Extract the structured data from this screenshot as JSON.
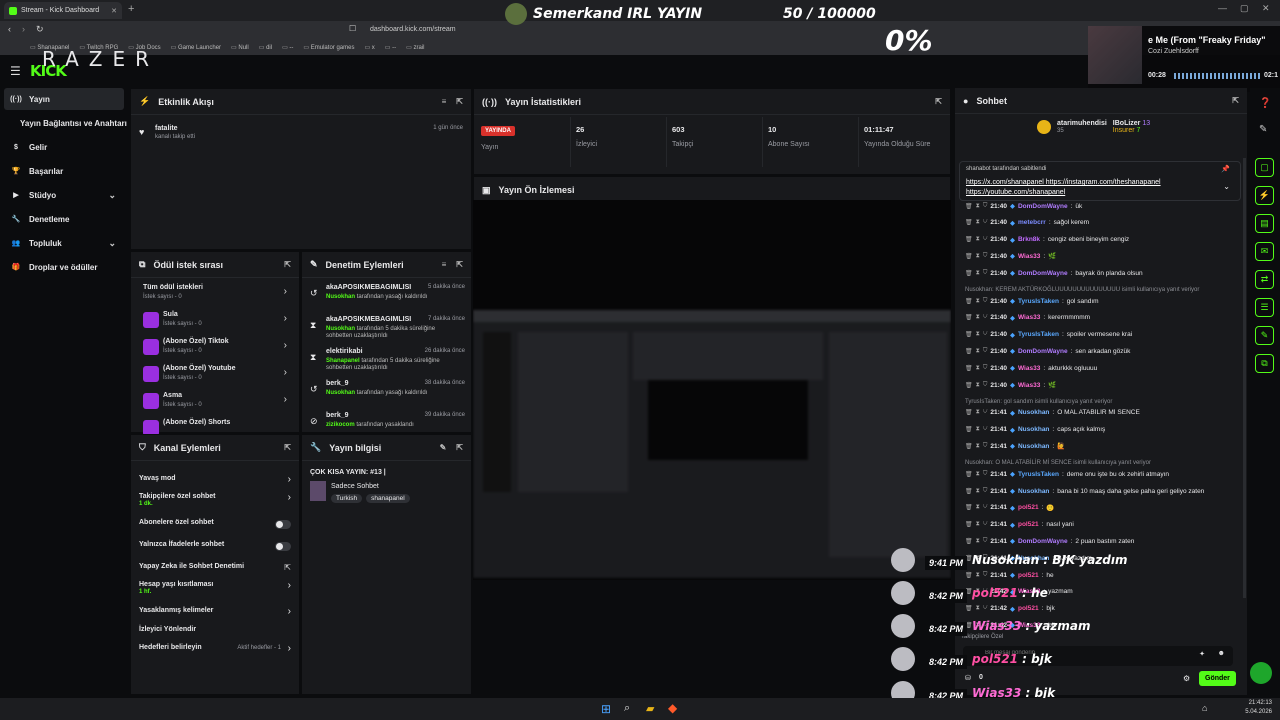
{
  "browser": {
    "tab_title": "Stream - Kick Dashboard",
    "url": "dashboard.kick.com/stream",
    "bookmarks": [
      "Shanapanel",
      "Twitch RPG",
      "Job Docs",
      "Game Launcher",
      "Null",
      "dil",
      "--",
      "Emulator games",
      "x",
      "--",
      "zrail"
    ]
  },
  "overlay": {
    "razer_logo": "RAZER",
    "banner_title": "Semerkand IRL YAYIN",
    "sub_goal": "50 / 100000",
    "percent": "0%",
    "music": {
      "title": "e Me (From \"Freaky Friday\"",
      "artist": "Cozi Zuehlsdorff",
      "time_start": "00:28",
      "time_end": "02:1"
    }
  },
  "sidebar": {
    "logo": "KICK",
    "items": [
      {
        "label": "Yayın",
        "icon": "broadcast-icon",
        "active": true
      },
      {
        "label": "Yayın Bağlantısı ve Anahtarı"
      },
      {
        "label": "Gelir",
        "icon": "money-icon"
      },
      {
        "label": "Başarılar",
        "icon": "trophy-icon"
      },
      {
        "label": "Stüdyo",
        "icon": "camera-icon",
        "expandable": true
      },
      {
        "label": "Denetleme",
        "icon": "wrench-icon"
      },
      {
        "label": "Topluluk",
        "icon": "people-icon",
        "expandable": true
      },
      {
        "label": "Droplar ve ödüller",
        "icon": "gift-icon"
      }
    ]
  },
  "activity": {
    "title": "Etkinlik Akışı",
    "items": [
      {
        "user": "fatalite",
        "desc": "kanalı takip etti",
        "time": "1 gün önce"
      }
    ]
  },
  "stats": {
    "title": "Yayın İstatistikleri",
    "status_badge": "YAYINDA",
    "status_label": "Yayın",
    "cells": [
      {
        "value": "26",
        "label": "İzleyici"
      },
      {
        "value": "603",
        "label": "Takipçi"
      },
      {
        "value": "10",
        "label": "Abone Sayısı"
      },
      {
        "value": "01:11:47",
        "label": "Yayında Olduğu Süre"
      }
    ]
  },
  "preview": {
    "title": "Yayın Ön İzlemesi"
  },
  "rewards": {
    "title": "Ödül istek sırası",
    "items": [
      {
        "name": "Tüm ödül istekleri",
        "sub": "İstek sayısı - 0"
      },
      {
        "name": "Sula",
        "sub": "İstek sayısı - 0"
      },
      {
        "name": "(Abone Özel) Tiktok",
        "sub": "İstek sayısı - 0"
      },
      {
        "name": "(Abone Özel) Youtube",
        "sub": "İstek sayısı - 0"
      },
      {
        "name": "Asma",
        "sub": "İstek sayısı - 0"
      },
      {
        "name": "(Abone Özel) Shorts",
        "sub": ""
      }
    ]
  },
  "modactions": {
    "title": "Denetim Eylemleri",
    "items": [
      {
        "user": "akaAPOSIKMEBAGIMLISI",
        "time": "5 dakika önce",
        "by": "Nusokhan",
        "desc": "tarafından yasağı kaldırıldı"
      },
      {
        "user": "akaAPOSIKMEBAGIMLISI",
        "time": "7 dakika önce",
        "by": "Nusokhan",
        "desc": "tarafından 5 dakika süreliğine sohbetten uzaklaştırıldı"
      },
      {
        "user": "elektirikabi",
        "time": "26 dakika önce",
        "by": "Shanapanel",
        "desc": "tarafından 5 dakika süreliğine sohbetten uzaklaştırıldı"
      },
      {
        "user": "berk_9",
        "time": "38 dakika önce",
        "by": "Nusokhan",
        "desc": "tarafından yasağı kaldırıldı"
      },
      {
        "user": "berk_9",
        "time": "39 dakika önce",
        "by": "zizikocom",
        "desc": "tarafından yasaklandı"
      }
    ]
  },
  "channel": {
    "title": "Kanal Eylemleri",
    "items": [
      {
        "label": "Yavaş mod",
        "sub": ""
      },
      {
        "label": "Takipçilere özel sohbet",
        "sub": "1 dk."
      },
      {
        "label": "Abonelere özel sohbet",
        "sub": ""
      },
      {
        "label": "Yalnızca İfadelerle sohbet",
        "sub": ""
      },
      {
        "label": "Yapay Zeka ile Sohbet Denetimi",
        "sub": ""
      },
      {
        "label": "Hesap yaşı kısıtlaması",
        "sub": "1 hf."
      },
      {
        "label": "Yasaklanmış kelimeler",
        "sub": ""
      },
      {
        "label": "İzleyici Yönlendir",
        "sub": ""
      },
      {
        "label": "Hedefleri belirleyin",
        "sub": "",
        "extra": "Aktif hedefler - 1"
      }
    ]
  },
  "streaminfo": {
    "title": "Yayın bilgisi",
    "stream_title": "ÇOK KISA YAYIN: #13 |",
    "category": "Sadece Sohbet",
    "tags": [
      "Turkish",
      "shanapanel"
    ]
  },
  "chat": {
    "title": "Sohbet",
    "top_gifters": [
      {
        "name": "atarimuhendisi",
        "count": "35"
      },
      {
        "name": "IBoLizer",
        "count": "13"
      },
      {
        "name": "Insurer",
        "count": "7"
      }
    ],
    "pinned_by": "shanabot tarafından sabitlendi",
    "pinned_text": "https://x.com/shanapanel https://instagram.com/theshanapanel https://youtube.com/shanapanel",
    "messages": [
      {
        "t": "21:40",
        "user": "DomDomWayne",
        "color": "#b07cff",
        "text": "ük"
      },
      {
        "t": "21:40",
        "user": "metebcrr",
        "color": "#7c8cff",
        "text": "sağol kerem"
      },
      {
        "t": "21:40",
        "user": "Brkn8k",
        "color": "#c06bff",
        "text": "cengiz ebeni bineyim cengiz"
      },
      {
        "t": "21:40",
        "user": "Wias33",
        "color": "#ff6bd5",
        "text": "🌿"
      },
      {
        "t": "21:40",
        "user": "DomDomWayne",
        "color": "#b07cff",
        "text": "bayrak ön planda olsun"
      },
      {
        "reply": "Nusokhan: KEREM AKTÜRKOĞLUUUUUUUUUUUUUUU isimli kullanıcıya yanıt veriyor"
      },
      {
        "t": "21:40",
        "user": "TyrusIsTaken",
        "color": "#5aa9ff",
        "text": "gol sandım"
      },
      {
        "t": "21:40",
        "user": "Wias33",
        "color": "#ff6bd5",
        "text": "kerermmmmm"
      },
      {
        "t": "21:40",
        "user": "TyrusIsTaken",
        "color": "#5aa9ff",
        "text": "spoiler vermesene krai"
      },
      {
        "t": "21:40",
        "user": "DomDomWayne",
        "color": "#b07cff",
        "text": "sen arkadan gözük"
      },
      {
        "t": "21:40",
        "user": "Wias33",
        "color": "#ff6bd5",
        "text": "akturkkk ogluuuu"
      },
      {
        "t": "21:40",
        "user": "Wias33",
        "color": "#ff6bd5",
        "text": "🌿"
      },
      {
        "reply": "TyrusIsTaken: gol sandım isimli kullanıcıya yanıt veriyor"
      },
      {
        "t": "21:41",
        "user": "Nusokhan",
        "color": "#7cb8ff",
        "text": "O MAL ATABİLİR Mİ SENCE"
      },
      {
        "t": "21:41",
        "user": "Nusokhan",
        "color": "#7cb8ff",
        "text": "caps açık kalmış"
      },
      {
        "t": "21:41",
        "user": "Nusokhan",
        "color": "#7cb8ff",
        "text": "🙋"
      },
      {
        "reply": "Nusokhan: O MAL ATABİLİR Mİ SENCE isimli kullanıcıya yanıt veriyor"
      },
      {
        "t": "21:41",
        "user": "TyrusIsTaken",
        "color": "#5aa9ff",
        "text": "deme onu işte bu ok zehirli atmayın"
      },
      {
        "t": "21:41",
        "user": "Nusokhan",
        "color": "#7cb8ff",
        "text": "bana bi 10 maaş daha gelse paha geri geliyo zaten"
      },
      {
        "t": "21:41",
        "user": "pol521",
        "color": "#ff4fa3",
        "text": "🙂"
      },
      {
        "t": "21:41",
        "user": "pol521",
        "color": "#ff4fa3",
        "text": "nasıl yani"
      },
      {
        "t": "21:41",
        "user": "DomDomWayne",
        "color": "#b07cff",
        "text": "2 puan bastım zaten"
      },
      {
        "t": "21:41",
        "user": "Nusokhan",
        "color": "#7cb8ff",
        "text": "BJK yazdım"
      },
      {
        "t": "21:41",
        "user": "pol521",
        "color": "#ff4fa3",
        "text": "he"
      },
      {
        "t": "21:42",
        "user": "Wias33",
        "color": "#ff6bd5",
        "text": "yazmam"
      },
      {
        "t": "21:42",
        "user": "pol521",
        "color": "#ff4fa3",
        "text": "bjk"
      },
      {
        "t": "21:42",
        "user": "Wias33",
        "color": "#ff6bd5",
        "text": "bjk"
      }
    ],
    "followers_only": "Takipçilere Özel",
    "input_placeholder": "Bir mesaj gönderin",
    "count": "0",
    "send_label": "Gönder"
  },
  "overlay_chat": [
    {
      "time": "9:41 PM",
      "user": "Nusokhan",
      "text": "BJK yazdım",
      "color": "#ffffff"
    },
    {
      "time": "8:42 PM",
      "user": "pol521",
      "text": "he",
      "color": "#ff4fa3"
    },
    {
      "time": "8:42 PM",
      "user": "Wias33",
      "text": "yazmam",
      "color": "#ff6bd5"
    },
    {
      "time": "8:42 PM",
      "user": "pol521",
      "text": "bjk",
      "color": "#ff4fa3"
    },
    {
      "time": "8:42 PM",
      "user": "Wias33",
      "text": "bjk",
      "color": "#ff6bd5"
    }
  ],
  "taskbar": {
    "time": "21:42:13",
    "date": "5.04.2026"
  }
}
